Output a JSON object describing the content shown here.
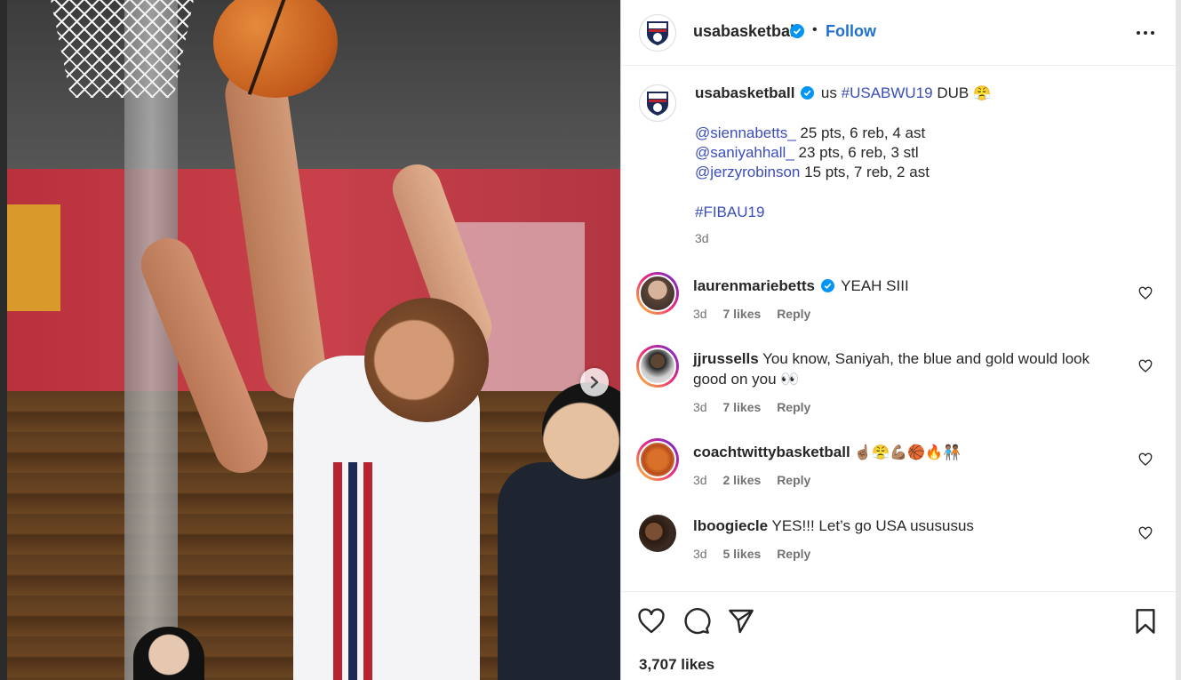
{
  "post": {
    "username": "usabasketball",
    "follow_label": "Follow",
    "separator": "•",
    "likes_count": "3,707 likes"
  },
  "caption": {
    "username": "usabasketball",
    "text_prefix": "us",
    "hashtag1": "#USABWU19",
    "text_suffix": "DUB",
    "emoji": "😤",
    "stat_lines": [
      {
        "handle": "@siennabetts_",
        "stats": "25 pts, 6 reb, 4 ast"
      },
      {
        "handle": "@saniyahhall_",
        "stats": "23 pts, 6 reb, 3 stl"
      },
      {
        "handle": "@jerzyrobinson",
        "stats": "15 pts, 7 reb, 2 ast"
      }
    ],
    "hashtag2": "#FIBAU19",
    "time": "3d"
  },
  "comments": [
    {
      "username": "laurenmariebetts",
      "verified": true,
      "text": "YEAH SIII",
      "time": "3d",
      "likes": "7 likes",
      "reply": "Reply"
    },
    {
      "username": "jjrussells",
      "verified": false,
      "text": "You know, Saniyah, the blue and gold would look good on you 👀",
      "time": "3d",
      "likes": "7 likes",
      "reply": "Reply"
    },
    {
      "username": "coachtwittybasketball",
      "verified": false,
      "text": "☝🏽😤💪🏽🏀🔥🧑🏽‍🤝‍🧑🏾",
      "time": "3d",
      "likes": "2 likes",
      "reply": "Reply"
    },
    {
      "username": "lboogiecle",
      "verified": false,
      "text": "YES!!! Let’s go USA usususus",
      "time": "3d",
      "likes": "5 likes",
      "reply": "Reply"
    }
  ],
  "colors": {
    "link": "#3a4db8",
    "follow": "#1f6fd1",
    "verified": "#0095f6"
  },
  "icons": [
    "chevron-right-icon",
    "more-icon",
    "verified-icon",
    "heart-icon",
    "comment-icon",
    "share-icon",
    "bookmark-icon"
  ]
}
